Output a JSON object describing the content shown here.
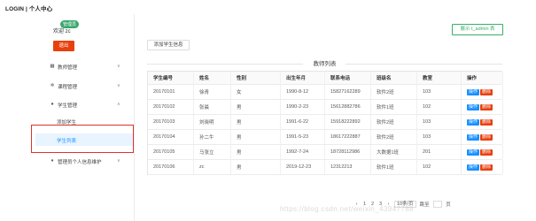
{
  "app": {
    "title": "LOGIN | 个人中心"
  },
  "sidebar": {
    "role_badge": "管理员",
    "welcome": "欢迎 zc",
    "logout_label": "退出",
    "menu": [
      {
        "label": "教师管理",
        "icon": "grid-icon"
      },
      {
        "label": "课程管理",
        "icon": "gear-icon"
      },
      {
        "label": "学生管理",
        "icon": "user-icon"
      },
      {
        "label": "管理员个人信息维护",
        "icon": "location-icon"
      }
    ],
    "student_sub": [
      {
        "label": "添加学生"
      },
      {
        "label": "学生列表"
      }
    ]
  },
  "header": {
    "right_button": "展示 t_admin 表"
  },
  "toolbar": {
    "add_label": "添加学生信息"
  },
  "table": {
    "title": "教师列表",
    "columns": [
      "学生编号",
      "姓名",
      "性别",
      "出生年月",
      "联系电话",
      "班级名",
      "教室",
      "操作"
    ],
    "op_label": "操作",
    "del_label": "删除",
    "rows": [
      {
        "id": "20170101",
        "name": "徐青",
        "gender": "女",
        "birth": "1990-8-12",
        "phone": "15827162289",
        "class": "软件2班",
        "room": "103"
      },
      {
        "id": "20170102",
        "name": "张晨",
        "gender": "男",
        "birth": "1990-2-23",
        "phone": "15612882786",
        "class": "软件1班",
        "room": "102"
      },
      {
        "id": "20170103",
        "name": "刘晓明",
        "gender": "男",
        "birth": "1991-6-22",
        "phone": "15918222892",
        "class": "软件2班",
        "room": "103"
      },
      {
        "id": "20170104",
        "name": "孙二牛",
        "gender": "男",
        "birth": "1991-5-23",
        "phone": "18617222887",
        "class": "软件2班",
        "room": "103"
      },
      {
        "id": "20170105",
        "name": "马张立",
        "gender": "男",
        "birth": "1992-7-24",
        "phone": "18728112986",
        "class": "大数据1班",
        "room": "201"
      },
      {
        "id": "20170106",
        "name": "zc",
        "gender": "男",
        "birth": "2019-12-23",
        "phone": "12312213",
        "class": "软件1班",
        "room": "102"
      }
    ]
  },
  "pager": {
    "prev": "‹",
    "pages": [
      "1",
      "2",
      "3"
    ],
    "next": "›",
    "size": "10条/页",
    "goto_label": "跳至",
    "page_unit": "页"
  },
  "watermark": "https://blog.csdn.net/weixin_43947788"
}
